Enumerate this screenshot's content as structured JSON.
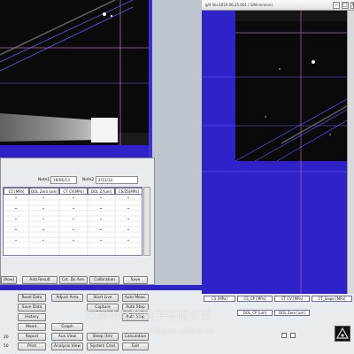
{
  "left_window": {
    "fields": {
      "note1_label": "Note1",
      "note1_value": "19/06/13",
      "note2_label": "Note2",
      "note2_value": "2/11/13"
    },
    "table": {
      "headers": [
        "C5 [MPa]",
        "DOL Zero [um]",
        "CT CV[MPa]",
        "DOL Z/[um]",
        "CS/ZS[MPa]"
      ],
      "rows": 12
    },
    "buttons": {
      "row_btn": "(Row)",
      "add_result": "Add Result",
      "cst_ds_ave": "Cst. Ds.Ave.",
      "calibration": "Calibration",
      "save": "Save"
    }
  },
  "right_window": {
    "title": "g/d Ver.2019.06.25.001  ( S/N:nnnnnn)",
    "headers": [
      "CS [MPa]",
      "CS_CP [MPa]",
      "CT CV [MPa]",
      "CT_Slope [MPa]"
    ],
    "headers2": [
      "DOL_CP [um]",
      "DOL Zero [um]"
    ]
  },
  "control_panel": {
    "left_labels": [
      "20",
      "50"
    ],
    "col1": [
      "Read Data",
      "Save Data",
      "History",
      "Maint.",
      "Report",
      "Print"
    ],
    "col2": [
      "Adjust Area",
      "",
      "",
      "Graph",
      "Aux View",
      "Analysis View"
    ],
    "col3": [
      "Start Live",
      "Capture",
      "",
      "",
      "Sleep (tm)",
      "System Cmd"
    ],
    "col4": [
      "Auto Meas.",
      "Auto Stop",
      "Auto Stop",
      "",
      "Calculation",
      "Exit"
    ]
  },
  "watermark": {
    "text": "深圳市航颖电子有限公司",
    "url": "rohs.cn.china.cn"
  },
  "colors": {
    "panel_blue": "#2e22c8",
    "dark_image": "#0c0c0c",
    "grey_bg": "#bfc5cc"
  }
}
